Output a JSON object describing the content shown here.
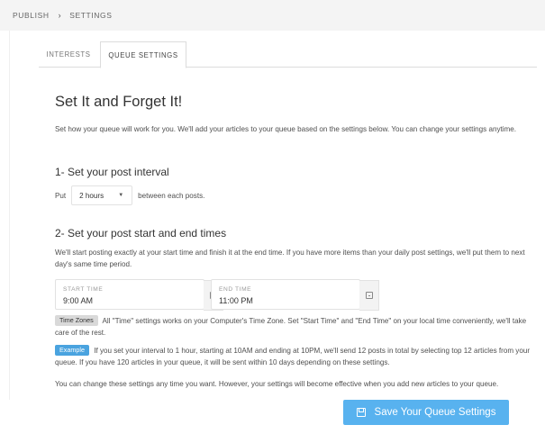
{
  "breadcrumb": {
    "root": "PUBLISH",
    "separator": "›",
    "current": "SETTINGS"
  },
  "tabs": [
    {
      "label": "INTERESTS",
      "active": false
    },
    {
      "label": "QUEUE SETTINGS",
      "active": true
    }
  ],
  "main": {
    "title": "Set It and Forget It!",
    "intro": "Set how your queue will work for you. We'll add your articles to your queue based on the settings below. You can change your settings anytime.",
    "interval": {
      "heading": "1- Set your post interval",
      "prefix": "Put",
      "selected": "2 hours",
      "suffix": "between each posts."
    },
    "times": {
      "heading": "2- Set your post start and end times",
      "description": "We'll start posting exactly at your start time and finish it at the end time. If you have more items than your daily post settings, we'll put them to next day's same time period.",
      "start_label": "START TIME",
      "start_value": "9:00 AM",
      "end_label": "END TIME",
      "end_value": "11:00 PM"
    },
    "timezone_badge": "Time Zones",
    "timezone_text": "All \"Time\" settings works on your Computer's Time Zone. Set \"Start Time\" and \"End Time\" on your local time conveniently, we'll take care of the rest.",
    "example_badge": "Example",
    "example_text": "If you set your interval to 1 hour, starting at 10AM and ending at 10PM, we'll send 12 posts in total by selecting top 12 articles from your queue. If you have 120 articles in your queue, it will be sent within 10 days depending on these settings.",
    "footer_note": "You can change these settings any time you want. However, your settings will become effective when you add new articles to your queue."
  },
  "save_button": {
    "label": "Save Your Queue Settings",
    "icon": "floppy-disk-icon",
    "color": "#58b2ef"
  }
}
